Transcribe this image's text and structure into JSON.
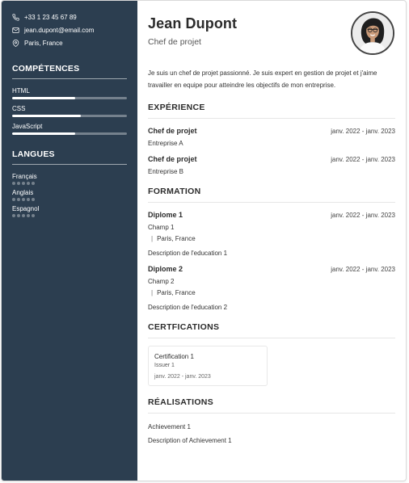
{
  "contact": {
    "phone": "+33 1 23 45 67 89",
    "email": "jean.dupont@email.com",
    "location": "Paris, France"
  },
  "skills_section": {
    "title": "COMPÉTENCES",
    "items": [
      {
        "name": "HTML",
        "level": 0.55
      },
      {
        "name": "CSS",
        "level": 0.6
      },
      {
        "name": "JavaScript",
        "level": 0.55
      }
    ]
  },
  "languages_section": {
    "title": "LANGUES",
    "items": [
      {
        "name": "Français",
        "level": 0
      },
      {
        "name": "Anglais",
        "level": 0
      },
      {
        "name": "Espagnol",
        "level": 0
      }
    ]
  },
  "header": {
    "name": "Jean Dupont",
    "role": "Chef de projet"
  },
  "summary": "Je suis un chef de projet passionné. Je suis expert en gestion de projet et j'aime travailler en equipe pour atteindre les objectifs de mon entreprise.",
  "experience": {
    "title": "EXPÉRIENCE",
    "items": [
      {
        "title": "Chef de projet",
        "dates": "janv. 2022 - janv. 2023",
        "company": "Entreprise A"
      },
      {
        "title": "Chef de projet",
        "dates": "janv. 2022 - janv. 2023",
        "company": "Entreprise B"
      }
    ]
  },
  "education": {
    "title": "FORMATION",
    "items": [
      {
        "title": "Diplome 1",
        "dates": "janv. 2022 - janv. 2023",
        "field": "Champ 1",
        "separator": "|",
        "location": "Paris, France",
        "description": "Description de l'education 1"
      },
      {
        "title": "Diplome 2",
        "dates": "janv. 2022 - janv. 2023",
        "field": "Champ 2",
        "separator": "|",
        "location": "Paris, France",
        "description": "Description de l'education 2"
      }
    ]
  },
  "certifications": {
    "title": "CERTFICATIONS",
    "items": [
      {
        "name": "Certification 1",
        "issuer": "Issuer 1",
        "dates": "janv. 2022 - janv. 2023"
      }
    ]
  },
  "achievements": {
    "title": "RÉALISATIONS",
    "items": [
      {
        "title": "Achievement 1",
        "description": "Description of Achievement 1"
      }
    ]
  },
  "icons": [
    "phone-icon",
    "email-icon",
    "location-pin-icon"
  ],
  "colors": {
    "sidebar_bg": "#2c3e50",
    "sidebar_text": "#ffffff",
    "heading": "#2b2b2b"
  }
}
